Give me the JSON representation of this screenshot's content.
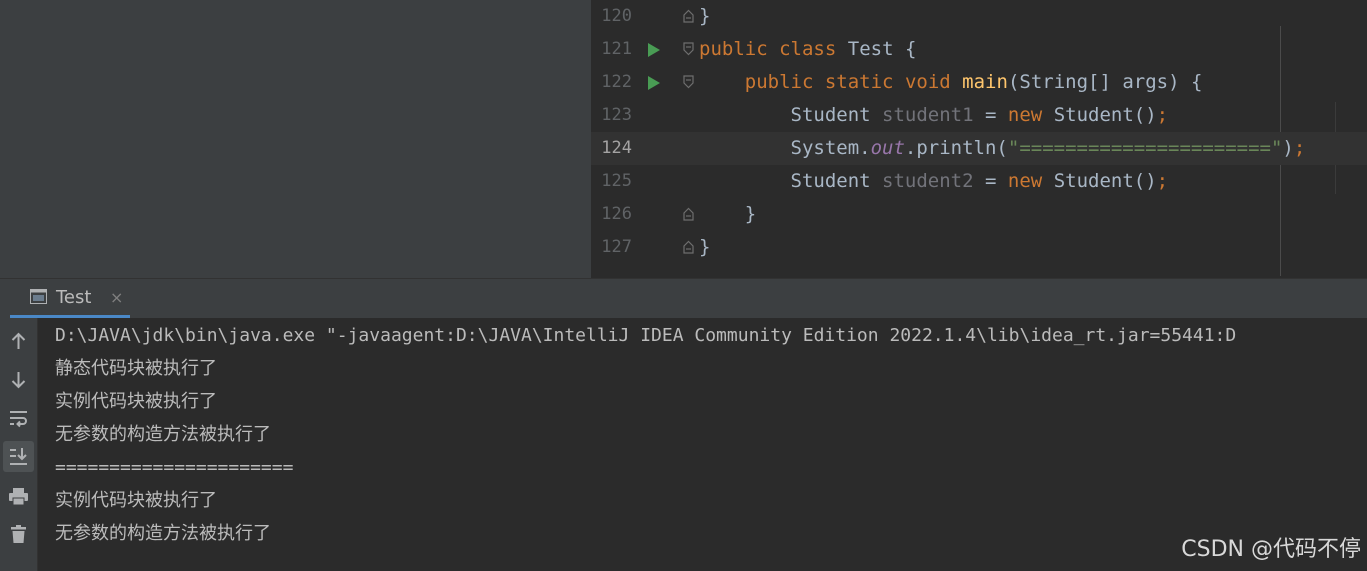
{
  "editor": {
    "lines": [
      {
        "num": "120"
      },
      {
        "num": "121"
      },
      {
        "num": "122"
      },
      {
        "num": "123"
      },
      {
        "num": "124"
      },
      {
        "num": "125"
      },
      {
        "num": "126"
      },
      {
        "num": "127"
      }
    ],
    "tokens": {
      "brace_close": "}",
      "kw_public": "public",
      "kw_class": "class",
      "class_name": "Test",
      "brace_open": "{",
      "kw_static": "static",
      "kw_void": "void",
      "fn_main": "main",
      "params": "(String[] args)",
      "type_student": "Student",
      "var_student1": "student1",
      "assign": "=",
      "kw_new": "new",
      "ctor_call": "Student()",
      "semicolon": ";",
      "system": "System.",
      "field_out": "out",
      "println_open": ".println(",
      "string_literal": "\"======================\"",
      "println_close": ")",
      "var_student2": "student2"
    }
  },
  "run_panel": {
    "tab_label": "Test",
    "tab_close": "×",
    "console_lines": [
      "D:\\JAVA\\jdk\\bin\\java.exe \"-javaagent:D:\\JAVA\\IntelliJ IDEA Community Edition 2022.1.4\\lib\\idea_rt.jar=55441:D",
      "静态代码块被执行了",
      "实例代码块被执行了",
      "无参数的构造方法被执行了",
      "======================",
      "实例代码块被执行了",
      "无参数的构造方法被执行了"
    ]
  },
  "toolbar_icons": [
    "arrow-up-icon",
    "arrow-down-icon",
    "soft-wrap-icon",
    "scroll-to-end-icon",
    "print-icon",
    "trash-icon"
  ],
  "watermark": "CSDN @代码不停",
  "colors": {
    "keyword": "#cc7832",
    "function": "#ffc66d",
    "string": "#6a8759",
    "field": "#9876aa",
    "run_green": "#499c54",
    "tab_accent": "#4a88c7"
  }
}
